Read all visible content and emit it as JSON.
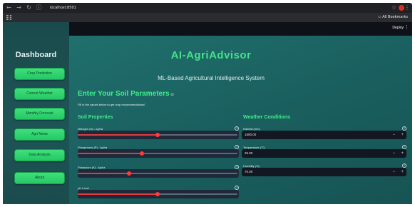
{
  "browser": {
    "url": "localhost:8501",
    "bookmarks_folder": "All Bookmarks"
  },
  "sidebar": {
    "title": "Dashboard",
    "items": [
      {
        "label": "Crop Prediction"
      },
      {
        "label": "Current Weather"
      },
      {
        "label": "Monthly Forecast"
      },
      {
        "label": "Agri News"
      },
      {
        "label": "Data Analysis"
      },
      {
        "label": "About"
      }
    ]
  },
  "header": {
    "deploy_label": "Deploy"
  },
  "main": {
    "title": "AI-AgriAdvisor",
    "subtitle": "ML-Based Agricultural Intelligence System",
    "section_title": "Enter Your Soil Parameters",
    "hint": "Fill in the values below to get crop recommendations!",
    "soil": {
      "title": "Soil Properties",
      "fields": [
        {
          "label": "Nitrogen (N) - kg/ha",
          "fraction": 0.5
        },
        {
          "label": "Phosphorus (P) - kg/ha",
          "fraction": 0.4
        },
        {
          "label": "Potassium (K) - kg/ha",
          "fraction": 0.32
        },
        {
          "label": "pH Level",
          "fraction": 0.5
        }
      ]
    },
    "weather": {
      "title": "Weather Conditions",
      "fields": [
        {
          "label": "Rainfall (mm)",
          "value": "1500.00"
        },
        {
          "label": "Temperature (°C)",
          "value": "25.00"
        },
        {
          "label": "Humidity (%)",
          "value": "70.00"
        }
      ]
    }
  },
  "colors": {
    "accent_green": "#3ef089",
    "slider_red": "#e23b3b",
    "sidebar_button": "#25c866"
  }
}
